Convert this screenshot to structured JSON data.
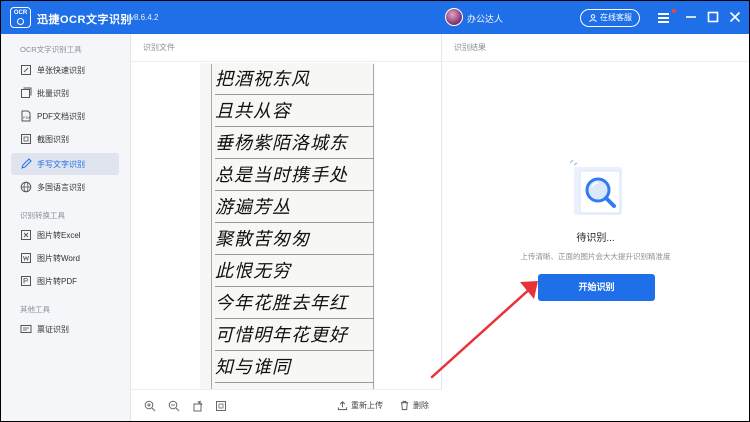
{
  "app": {
    "name": "迅捷OCR文字识别",
    "version": "v8.6.4.2",
    "logo_text": "OCR"
  },
  "user": {
    "name": "办公达人"
  },
  "header": {
    "service_label": "在线客服"
  },
  "colors": {
    "accent": "#1e6fe8",
    "arrow": "#e8323a",
    "notification": "#ff3b3b"
  },
  "sidebar": {
    "sections": [
      {
        "title": "OCR文字识别工具"
      },
      {
        "title": "识别转换工具"
      },
      {
        "title": "其他工具"
      }
    ],
    "items": [
      {
        "label": "单张快速识别",
        "icon": "single-scan-icon",
        "active": false
      },
      {
        "label": "批量识别",
        "icon": "batch-icon",
        "active": false
      },
      {
        "label": "PDF文档识别",
        "icon": "pdf-icon",
        "active": false
      },
      {
        "label": "截图识别",
        "icon": "screenshot-icon",
        "active": false
      },
      {
        "label": "手写文字识别",
        "icon": "pen-icon",
        "active": true
      },
      {
        "label": "多国语言识别",
        "icon": "globe-icon",
        "active": false
      },
      {
        "label": "图片转Excel",
        "icon": "excel-icon",
        "active": false
      },
      {
        "label": "图片转Word",
        "icon": "word-icon",
        "active": false
      },
      {
        "label": "图片转PDF",
        "icon": "pdf-convert-icon",
        "active": false
      },
      {
        "label": "票证识别",
        "icon": "card-icon",
        "active": false
      }
    ]
  },
  "left_panel": {
    "title": "识别文件",
    "handwriting_lines": [
      "把酒祝东风",
      "且共从容",
      "垂杨紫陌洛城东",
      "总是当时携手处",
      "游遍芳丛",
      "聚散苦匆匆",
      "此恨无穷",
      "今年花胜去年红",
      "可惜明年花更好",
      "知与谁同"
    ],
    "reupload_label": "重新上传",
    "delete_label": "删除"
  },
  "right_panel": {
    "title": "识别结果",
    "status": "待识别...",
    "tip": "上传清晰、正面的图片会大大提升识别精准度",
    "start_label": "开始识别"
  }
}
